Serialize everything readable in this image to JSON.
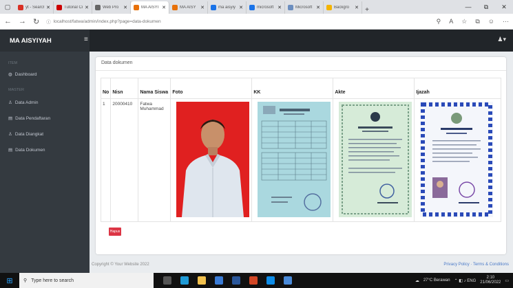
{
  "browser": {
    "tabs": [
      {
        "label": "yt - Search",
        "color": "#d93025"
      },
      {
        "label": "Tutorial Cr",
        "color": "#cc0000"
      },
      {
        "label": "Web Pro",
        "color": "#666666"
      },
      {
        "label": "MA AISYI",
        "color": "#e8710a",
        "active": true
      },
      {
        "label": "MA AISY",
        "color": "#e8710a"
      },
      {
        "label": "ma aisyiy",
        "color": "#1a73e8"
      },
      {
        "label": "microsoft",
        "color": "#1a73e8"
      },
      {
        "label": "Microsoft",
        "color": "#6c8ebf"
      },
      {
        "label": "Backgro",
        "color": "#f4b400"
      }
    ],
    "url": "localhost/fatwa/admin/index.php?page=data-dokumen",
    "win_controls": [
      "—",
      "⧉",
      "✕"
    ]
  },
  "app": {
    "brand": "MA AISYIYAH",
    "section1": "ITEM",
    "section2": "MASTER",
    "nav": [
      {
        "label": "Dashboard",
        "icon": "dashboard-icon",
        "glyph": "◍"
      },
      {
        "label": "Data Admin",
        "icon": "user-icon",
        "glyph": "♙"
      },
      {
        "label": "Data Pendaftaran",
        "icon": "list-icon",
        "glyph": "▤"
      },
      {
        "label": "Data Diangkat",
        "icon": "user-icon",
        "glyph": "♙"
      },
      {
        "label": "Data Dokumen",
        "icon": "list-icon",
        "glyph": "▤"
      }
    ]
  },
  "card": {
    "title": "Data dokumen",
    "delete_label": "Hapus"
  },
  "table": {
    "headers": [
      "No",
      "Nisn",
      "Nama Siswa",
      "Foto",
      "KK",
      "Akte",
      "Ijazah"
    ],
    "rows": [
      {
        "no": "1",
        "nisn": "20000410",
        "nama": "Fatwa Muhammad"
      }
    ]
  },
  "footer": {
    "copyright": "Copyright © Your Website 2022",
    "links": "Privacy Policy · Terms & Conditions"
  },
  "taskbar": {
    "search_placeholder": "Type here to search",
    "weather": "27°C Berawan",
    "time": "2:10",
    "date": "21/06/2022"
  },
  "colors": {
    "sidebar": "#343a40",
    "topbar": "#212529",
    "danger": "#dc3545",
    "photo_bg": "#e02020"
  }
}
